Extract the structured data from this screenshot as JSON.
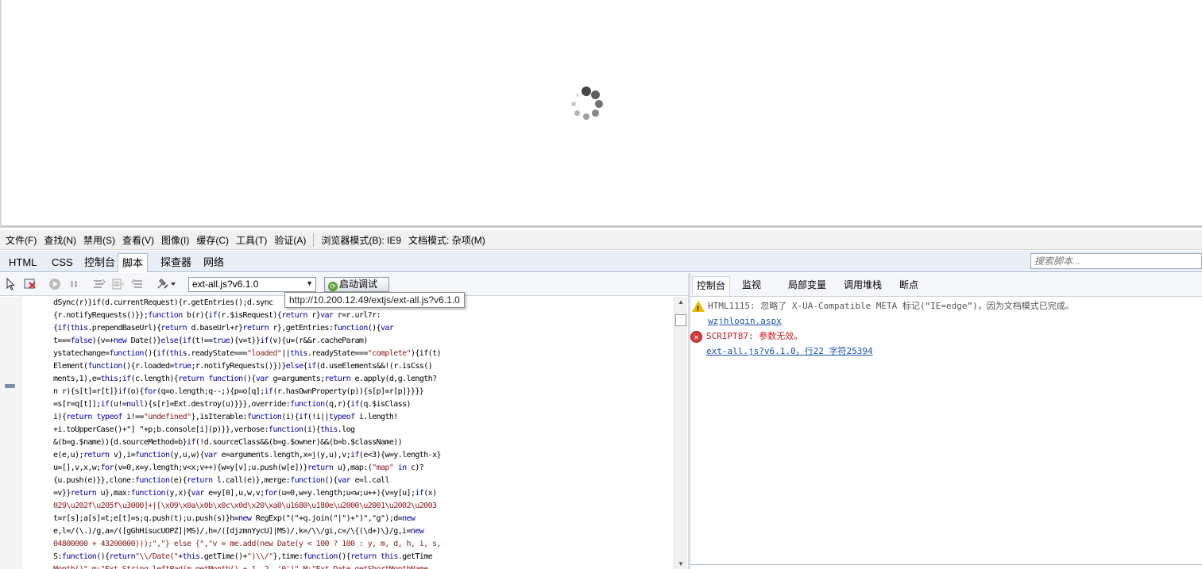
{
  "menubar": {
    "items": [
      "文件(F)",
      "查找(N)",
      "禁用(S)",
      "查看(V)",
      "图像(I)",
      "缓存(C)",
      "工具(T)",
      "验证(A)"
    ],
    "browser_mode_label": "浏览器模式(B):",
    "browser_mode_value": "IE9",
    "document_mode_label": "文档模式:",
    "document_mode_value": "杂项(M)"
  },
  "tabs": {
    "items": [
      "HTML",
      "CSS",
      "控制台",
      "脚本",
      "探查器",
      "网络"
    ],
    "active": "脚本",
    "search_placeholder": "搜索脚本..."
  },
  "toolbar": {
    "icons": [
      "select-element-icon",
      "clear-browser-cache-icon",
      "continue-icon",
      "pause-icon",
      "step-into-icon",
      "step-over-icon",
      "step-out-icon",
      "configuration-icon"
    ],
    "file_select_value": "ext-all.js?v6.1.0",
    "start_debug_label": "启动调试"
  },
  "tooltip": {
    "url": "http://10.200.12.49/extjs/ext-all.js?v6.1.0"
  },
  "code": {
    "lines": [
      [
        [
          "t",
          "dSync(r)}if(d.currentRequest){r.getEntries();d.sync"
        ]
      ],
      [
        [
          "t",
          "{r.notifyRequests()}};"
        ],
        [
          "k",
          "function"
        ],
        [
          "t",
          " b(r){"
        ],
        [
          "k",
          "if"
        ],
        [
          "t",
          "(r.$isRequest){"
        ],
        [
          "k",
          "return"
        ],
        [
          "t",
          " r}"
        ],
        [
          "k",
          "var"
        ],
        [
          "t",
          " r=r.url?r:"
        ]
      ],
      [
        [
          "t",
          "{"
        ],
        [
          "k",
          "if"
        ],
        [
          "t",
          "("
        ],
        [
          "k",
          "this"
        ],
        [
          "t",
          ".prependBaseUrl){"
        ],
        [
          "k",
          "return"
        ],
        [
          "t",
          " d.baseUrl+r}"
        ],
        [
          "k",
          "return"
        ],
        [
          "t",
          " r},getEntries:"
        ],
        [
          "k",
          "function"
        ],
        [
          "t",
          "(){"
        ],
        [
          "k",
          "var"
        ]
      ],
      [
        [
          "t",
          "t==="
        ],
        [
          "k",
          "false"
        ],
        [
          "t",
          "){v=+"
        ],
        [
          "k",
          "new"
        ],
        [
          "t",
          " Date()}"
        ],
        [
          "k",
          "else"
        ],
        [
          "t",
          "{"
        ],
        [
          "k",
          "if"
        ],
        [
          "t",
          "(t!=="
        ],
        [
          "k",
          "true"
        ],
        [
          "t",
          "){v=t}}"
        ],
        [
          "k",
          "if"
        ],
        [
          "t",
          "(v){u=(r&&r.cacheParam)"
        ]
      ],
      [
        [
          "t",
          "ystatechange="
        ],
        [
          "k",
          "function"
        ],
        [
          "t",
          "(){"
        ],
        [
          "k",
          "if"
        ],
        [
          "t",
          "("
        ],
        [
          "k",
          "this"
        ],
        [
          "t",
          ".readyState==="
        ],
        [
          "s",
          "\"loaded\""
        ],
        [
          "t",
          "||"
        ],
        [
          "k",
          "this"
        ],
        [
          "t",
          ".readyState==="
        ],
        [
          "s",
          "\"complete\""
        ],
        [
          "t",
          "){if(t)"
        ]
      ],
      [
        [
          "t",
          "Element("
        ],
        [
          "k",
          "function"
        ],
        [
          "t",
          "(){r.loaded="
        ],
        [
          "k",
          "true"
        ],
        [
          "t",
          ";r.notifyRequests()})}"
        ],
        [
          "k",
          "else"
        ],
        [
          "t",
          "{"
        ],
        [
          "k",
          "if"
        ],
        [
          "t",
          "(d.useElements&&!(r.isCss()"
        ]
      ],
      [
        [
          "t",
          "ments,1),e="
        ],
        [
          "k",
          "this"
        ],
        [
          "t",
          ";"
        ],
        [
          "k",
          "if"
        ],
        [
          "t",
          "(c.length){"
        ],
        [
          "k",
          "return"
        ],
        [
          "t",
          " "
        ],
        [
          "k",
          "function"
        ],
        [
          "t",
          "(){"
        ],
        [
          "k",
          "var"
        ],
        [
          "t",
          " g=arguments;"
        ],
        [
          "k",
          "return"
        ],
        [
          "t",
          " e.apply(d,g.length?"
        ]
      ],
      [
        [
          "t",
          "n r){s[t]=r[t]}"
        ],
        [
          "k",
          "if"
        ],
        [
          "t",
          "(o){"
        ],
        [
          "k",
          "for"
        ],
        [
          "t",
          "(q=o.length;q--;){p=o[q];"
        ],
        [
          "k",
          "if"
        ],
        [
          "t",
          "(r.hasOwnProperty(p)){s[p]=r[p]}}}}"
        ]
      ],
      [
        [
          "t",
          "=s[r=q[t]];"
        ],
        [
          "k",
          "if"
        ],
        [
          "t",
          "(u!="
        ],
        [
          "k",
          "null"
        ],
        [
          "t",
          "){s[r]=Ext.destroy(u)}}},override:"
        ],
        [
          "k",
          "function"
        ],
        [
          "t",
          "(q,r){"
        ],
        [
          "k",
          "if"
        ],
        [
          "t",
          "(q.$isClass)"
        ]
      ],
      [
        [
          "t",
          "i){"
        ],
        [
          "k",
          "return"
        ],
        [
          "t",
          " "
        ],
        [
          "k",
          "typeof"
        ],
        [
          "t",
          " i!=="
        ],
        [
          "s",
          "\"undefined\""
        ],
        [
          "t",
          "},isIterable:"
        ],
        [
          "k",
          "function"
        ],
        [
          "t",
          "(i){"
        ],
        [
          "k",
          "if"
        ],
        [
          "t",
          "(!i||"
        ],
        [
          "k",
          "typeof"
        ],
        [
          "t",
          " i.length!"
        ]
      ],
      [
        [
          "t",
          "+i.toUpperCase()+\"] \"+p;b.console[i](p)}},verbose:"
        ],
        [
          "k",
          "function"
        ],
        [
          "t",
          "(i){"
        ],
        [
          "k",
          "this"
        ],
        [
          "t",
          ".log"
        ]
      ],
      [
        [
          "t",
          "&(b=g.$name)){d.sourceMethod=b}"
        ],
        [
          "k",
          "if"
        ],
        [
          "t",
          "(!d.sourceClass&&(b=g.$owner)&&(b=b.$className))"
        ]
      ],
      [
        [
          "t",
          "e(e,u);"
        ],
        [
          "k",
          "return"
        ],
        [
          "t",
          " v},i="
        ],
        [
          "k",
          "function"
        ],
        [
          "t",
          "(y,u,w){"
        ],
        [
          "k",
          "var"
        ],
        [
          "t",
          " e=arguments.length,x=j(y,u),v;"
        ],
        [
          "k",
          "if"
        ],
        [
          "t",
          "(e<3){w=y.length-x}"
        ]
      ],
      [
        [
          "t",
          "u=[],v,x,w;"
        ],
        [
          "k",
          "for"
        ],
        [
          "t",
          "(v=0,x=y.length;v<x;v++){w=y[v];u.push(w[e])}"
        ],
        [
          "k",
          "return"
        ],
        [
          "t",
          " u},map:("
        ],
        [
          "s",
          "\"map\""
        ],
        [
          "t",
          " "
        ],
        [
          "k",
          "in"
        ],
        [
          "t",
          " c)?"
        ]
      ],
      [
        [
          "t",
          "{u.push(e)}},clone:"
        ],
        [
          "k",
          "function"
        ],
        [
          "t",
          "(e){"
        ],
        [
          "k",
          "return"
        ],
        [
          "t",
          " l.call(e)},merge:"
        ],
        [
          "k",
          "function"
        ],
        [
          "t",
          "(){"
        ],
        [
          "k",
          "var"
        ],
        [
          "t",
          " e=l.call"
        ]
      ],
      [
        [
          "t",
          "=v}}"
        ],
        [
          "k",
          "return"
        ],
        [
          "t",
          " u},max:"
        ],
        [
          "k",
          "function"
        ],
        [
          "t",
          "(y,x){"
        ],
        [
          "k",
          "var"
        ],
        [
          "t",
          " e=y[0],u,w,v;"
        ],
        [
          "k",
          "for"
        ],
        [
          "t",
          "(u=0,w=y.length;u<w;u++){v=y[u];"
        ],
        [
          "k",
          "if"
        ],
        [
          "t",
          "(x)"
        ]
      ],
      [
        [
          "s",
          "029\\u202f\\u205f\\u3000]+|[\\x09\\x0a\\x0b\\x0c\\x0d\\x20\\xa0\\u1680\\u180e\\u2000\\u2001\\u2002\\u2003"
        ]
      ],
      [
        [
          "t",
          "t=r[s];a[s]=t;e[t]=s;q.push(t);u.push(s)}h="
        ],
        [
          "k",
          "new"
        ],
        [
          "t",
          " RegExp(\"(\"+q.join(\"|\")+\")\",\"g\");d="
        ],
        [
          "k",
          "new"
        ]
      ],
      [
        [
          "t",
          "e,l=/(\\.)/g,a=/([gGhHisucUOPZ]|MS)/,h=/([djzmnYycU]|MS)/,k=/\\\\/gi,c=/\\{(\\d+)\\}/g,i="
        ],
        [
          "k",
          "new"
        ]
      ],
      [
        [
          "s",
          "04800000 + 43200000)));\",\"} else {\",\"v = me.add(new Date(y < 100 ? 100 : y, m, d, h, i, s,"
        ]
      ],
      [
        [
          "t",
          "S:"
        ],
        [
          "k",
          "function"
        ],
        [
          "t",
          "(){"
        ],
        [
          "k",
          "return"
        ],
        [
          "s",
          "\"\\\\/Date(\""
        ],
        [
          "t",
          "+"
        ],
        [
          "k",
          "this"
        ],
        [
          "t",
          ".getTime()+"
        ],
        [
          "s",
          "\")\\\\/\""
        ],
        [
          "t",
          "},time:"
        ],
        [
          "k",
          "function"
        ],
        [
          "t",
          "(){"
        ],
        [
          "k",
          "return"
        ],
        [
          "t",
          " "
        ],
        [
          "k",
          "this"
        ],
        [
          "t",
          ".getTime"
        ]
      ],
      [
        [
          "s",
          "Month()\",m:\"Ext.String.leftPad(m.getMonth() + 1, 2, '0')\",M:\"Ext.Date.getShortMonthName"
        ]
      ]
    ]
  },
  "right_panel": {
    "tabs": [
      "控制台",
      "监视",
      "局部变量",
      "调用堆栈",
      "断点"
    ],
    "active": "控制台",
    "messages": [
      {
        "type": "warning",
        "text": "HTML1115: 忽略了 X-UA-Compatible META 标记(“IE=edge”)，因为文档模式已完成。",
        "link": "wzjhlogin.aspx"
      },
      {
        "type": "error",
        "text": "SCRIPT87: 参数无效。",
        "link": "ext-all.js?v6.1.0，行22 字符25394"
      }
    ]
  },
  "colors": {
    "keyword": "#0000a8",
    "string": "#8a1a1a",
    "error": "#c81a1a",
    "link": "#1a4fa8",
    "warning": "#e9b800"
  }
}
